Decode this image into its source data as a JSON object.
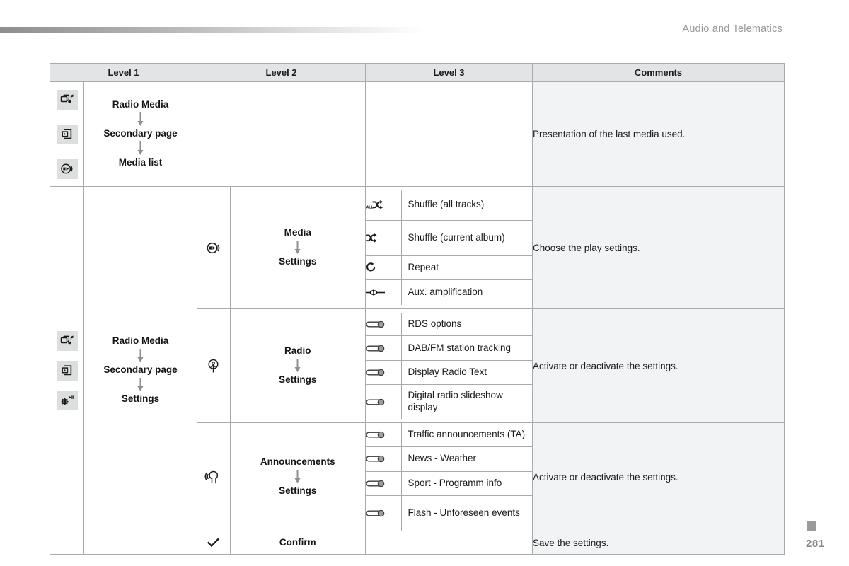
{
  "header": {
    "title": "Audio and Telematics"
  },
  "footer": {
    "page_number": "281"
  },
  "table": {
    "columns": [
      "Level 1",
      "Level 2",
      "Level 3",
      "Comments"
    ],
    "blocks": [
      {
        "level1": {
          "icons": [
            "radio-media-icon",
            "secondary-page-icon",
            "media-list-icon"
          ],
          "flow": [
            "Radio Media",
            "Secondary page",
            "Media list"
          ]
        },
        "level2_groups": [],
        "comment": "Presentation of the last media used."
      },
      {
        "level1": {
          "icons": [
            "radio-media-icon",
            "secondary-page-icon",
            "settings-gear-icon"
          ],
          "flow": [
            "Radio Media",
            "Secondary page",
            "Settings"
          ]
        },
        "level2_groups": [
          {
            "icon": "media-list-icon",
            "flow": [
              "Media",
              "Settings"
            ],
            "level3": [
              {
                "icon": "shuffle-all-icon",
                "label": "Shuffle (all tracks)"
              },
              {
                "icon": "shuffle-icon",
                "label": "Shuffle (current album)"
              },
              {
                "icon": "repeat-icon",
                "label": "Repeat"
              },
              {
                "icon": "aux-amplification-icon",
                "label": "Aux. amplification"
              }
            ],
            "comment": "Choose the play settings."
          },
          {
            "icon": "radio-antenna-icon",
            "flow": [
              "Radio",
              "Settings"
            ],
            "level3": [
              {
                "icon": "toggle-switch-icon",
                "label": "RDS options"
              },
              {
                "icon": "toggle-switch-icon",
                "label": "DAB/FM station tracking"
              },
              {
                "icon": "toggle-switch-icon",
                "label": "Display Radio Text"
              },
              {
                "icon": "toggle-switch-icon",
                "label": "Digital radio slideshow display"
              }
            ],
            "comment": "Activate or deactivate the settings."
          },
          {
            "icon": "announcements-voice-icon",
            "flow": [
              "Announcements",
              "Settings"
            ],
            "level3": [
              {
                "icon": "toggle-switch-icon",
                "label": "Traffic announcements (TA)"
              },
              {
                "icon": "toggle-switch-icon",
                "label": "News - Weather"
              },
              {
                "icon": "toggle-switch-icon",
                "label": "Sport - Programm info"
              },
              {
                "icon": "toggle-switch-icon",
                "label": "Flash - Unforeseen events"
              }
            ],
            "comment": "Activate or deactivate the settings."
          },
          {
            "icon": "checkmark-icon",
            "flow": [
              "Confirm"
            ],
            "level3": [],
            "comment": "Save the settings."
          }
        ]
      }
    ]
  },
  "colors": {
    "border": "#a8abae",
    "header_fill": "#e3e4e6",
    "comments_fill": "#f2f3f5",
    "icon_chip_fill": "#dddede",
    "muted_text": "#9a9a9a"
  }
}
